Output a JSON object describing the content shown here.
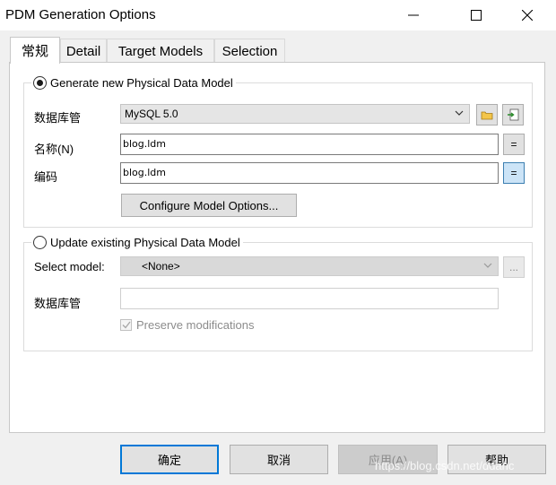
{
  "window": {
    "title": "PDM Generation Options"
  },
  "tabs": [
    {
      "label": "常规",
      "active": true
    },
    {
      "label": "Detail",
      "active": false
    },
    {
      "label": "Target Models",
      "active": false
    },
    {
      "label": "Selection",
      "active": false
    }
  ],
  "generate_group": {
    "option_label": "Generate new Physical Data Model",
    "selected": true,
    "dbms_label": "数据库管",
    "dbms_value": "MySQL 5.0",
    "name_label": "名称(N)",
    "name_value": "blog.ldm",
    "code_label": "编码",
    "code_value": "blog.ldm",
    "equals_button": "=",
    "configure_button": "Configure Model Options..."
  },
  "update_group": {
    "option_label": "Update existing Physical Data Model",
    "selected": false,
    "select_model_label": "Select model:",
    "select_model_value": "<None>",
    "more_button": "...",
    "dbms_label": "数据库管",
    "dbms_value": "",
    "preserve_label": "Preserve modifications",
    "preserve_checked": true
  },
  "footer": {
    "ok": "确定",
    "cancel": "取消",
    "apply": "应用(A)",
    "help": "帮助"
  },
  "watermark": "https://blog.csdn.net/ddahc",
  "icons": {
    "folder": "folder-icon",
    "import": "import-icon"
  },
  "colors": {
    "focus_border": "#0078d7",
    "pressed_button": "#cce4f7"
  }
}
